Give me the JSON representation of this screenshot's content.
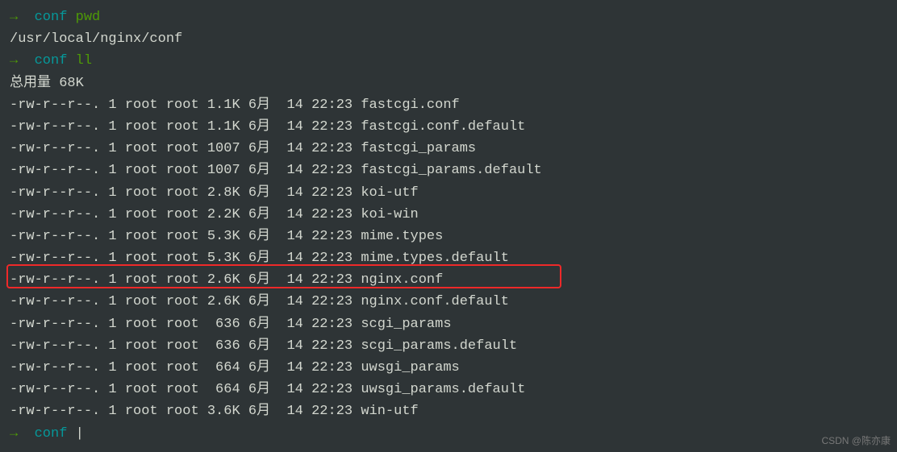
{
  "prompt": {
    "arrow": "→",
    "dir": "conf"
  },
  "commands": {
    "pwd": "pwd",
    "ll": "ll"
  },
  "pwd_output": "/usr/local/nginx/conf",
  "ll_summary": "总用量 68K",
  "files": [
    {
      "perm": "-rw-r--r--.",
      "links": "1",
      "owner": "root",
      "group": "root",
      "size": "1.1K",
      "month": "6月",
      "day": "14",
      "time": "22:23",
      "name": "fastcgi.conf"
    },
    {
      "perm": "-rw-r--r--.",
      "links": "1",
      "owner": "root",
      "group": "root",
      "size": "1.1K",
      "month": "6月",
      "day": "14",
      "time": "22:23",
      "name": "fastcgi.conf.default"
    },
    {
      "perm": "-rw-r--r--.",
      "links": "1",
      "owner": "root",
      "group": "root",
      "size": "1007",
      "month": "6月",
      "day": "14",
      "time": "22:23",
      "name": "fastcgi_params"
    },
    {
      "perm": "-rw-r--r--.",
      "links": "1",
      "owner": "root",
      "group": "root",
      "size": "1007",
      "month": "6月",
      "day": "14",
      "time": "22:23",
      "name": "fastcgi_params.default"
    },
    {
      "perm": "-rw-r--r--.",
      "links": "1",
      "owner": "root",
      "group": "root",
      "size": "2.8K",
      "month": "6月",
      "day": "14",
      "time": "22:23",
      "name": "koi-utf"
    },
    {
      "perm": "-rw-r--r--.",
      "links": "1",
      "owner": "root",
      "group": "root",
      "size": "2.2K",
      "month": "6月",
      "day": "14",
      "time": "22:23",
      "name": "koi-win"
    },
    {
      "perm": "-rw-r--r--.",
      "links": "1",
      "owner": "root",
      "group": "root",
      "size": "5.3K",
      "month": "6月",
      "day": "14",
      "time": "22:23",
      "name": "mime.types"
    },
    {
      "perm": "-rw-r--r--.",
      "links": "1",
      "owner": "root",
      "group": "root",
      "size": "5.3K",
      "month": "6月",
      "day": "14",
      "time": "22:23",
      "name": "mime.types.default"
    },
    {
      "perm": "-rw-r--r--.",
      "links": "1",
      "owner": "root",
      "group": "root",
      "size": "2.6K",
      "month": "6月",
      "day": "14",
      "time": "22:23",
      "name": "nginx.conf"
    },
    {
      "perm": "-rw-r--r--.",
      "links": "1",
      "owner": "root",
      "group": "root",
      "size": "2.6K",
      "month": "6月",
      "day": "14",
      "time": "22:23",
      "name": "nginx.conf.default"
    },
    {
      "perm": "-rw-r--r--.",
      "links": "1",
      "owner": "root",
      "group": "root",
      "size": " 636",
      "month": "6月",
      "day": "14",
      "time": "22:23",
      "name": "scgi_params"
    },
    {
      "perm": "-rw-r--r--.",
      "links": "1",
      "owner": "root",
      "group": "root",
      "size": " 636",
      "month": "6月",
      "day": "14",
      "time": "22:23",
      "name": "scgi_params.default"
    },
    {
      "perm": "-rw-r--r--.",
      "links": "1",
      "owner": "root",
      "group": "root",
      "size": " 664",
      "month": "6月",
      "day": "14",
      "time": "22:23",
      "name": "uwsgi_params"
    },
    {
      "perm": "-rw-r--r--.",
      "links": "1",
      "owner": "root",
      "group": "root",
      "size": " 664",
      "month": "6月",
      "day": "14",
      "time": "22:23",
      "name": "uwsgi_params.default"
    },
    {
      "perm": "-rw-r--r--.",
      "links": "1",
      "owner": "root",
      "group": "root",
      "size": "3.6K",
      "month": "6月",
      "day": "14",
      "time": "22:23",
      "name": "win-utf"
    }
  ],
  "watermark": "CSDN @陈亦康"
}
